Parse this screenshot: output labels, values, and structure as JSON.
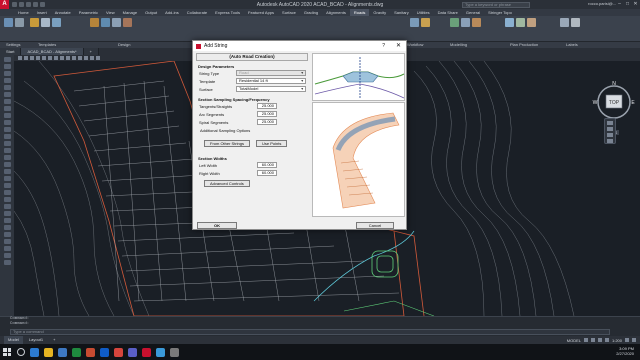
{
  "titlebar": {
    "app_title": "Autodesk AutoCAD 2020  ACAD_BCAD - Alignments.dwg",
    "search_placeholder": "Type a keyword or phrase",
    "user": "rocco.parisi@...",
    "logo_letter": "A"
  },
  "ribbon_tabs": [
    "Home",
    "Insert",
    "Annotate",
    "Parametric",
    "View",
    "Manage",
    "Output",
    "Add-ins",
    "Collaborate",
    "Express Tools",
    "Featured Apps",
    "Surface",
    "Grading",
    "Alignments",
    "Roads",
    "Gravity",
    "Sanitary",
    "Utilities",
    "Data Share",
    "General",
    "Stringer Topo"
  ],
  "active_tab_index": 14,
  "ribbon_panel_labels": [
    "Settings",
    "Templates",
    "Design",
    "Workflow",
    "Modelling",
    "Plan Production",
    "Labels"
  ],
  "file_tabs": [
    "Start",
    "ACAD_BCAD - Alignments*"
  ],
  "dialog": {
    "title": "Add String",
    "help": "?",
    "close": "✕",
    "subtitle": "(Auto Road Creation)",
    "design_params_heading": "Design Parameters",
    "string_type_label": "String Type",
    "string_type_value": "Road",
    "template_label": "Template",
    "template_value": "Residential 14 ft",
    "surface_label": "Surface",
    "surface_value": "TotalModel",
    "sampling_heading": "Section Sampling Spacing/Frequency",
    "tangents_label": "Tangents/Straights",
    "tangents_value": "25.000",
    "arc_label": "Arc Segments",
    "arc_value": "25.000",
    "spiral_label": "Spiral Segments",
    "spiral_value": "25.000",
    "additional_label": "Additional Sampling Options",
    "from_other_btn": "From Other Strings",
    "use_points_btn": "Use Points",
    "widths_heading": "Section Widths",
    "left_width_label": "Left Width",
    "left_width_value": "60.000",
    "right_width_label": "Right Width",
    "right_width_value": "60.000",
    "advanced_btn": "Advanced Controls",
    "ok_btn": "OK",
    "cancel_btn": "Cancel"
  },
  "viewcube": {
    "top": "TOP",
    "n": "N",
    "s": "S",
    "e": "E",
    "w": "W",
    "wcs": "WCS"
  },
  "command": {
    "line1": "Command:",
    "line2": "Command:",
    "placeholder": "Type a command"
  },
  "layout_tabs": [
    "Model",
    "Layout1",
    "+"
  ],
  "status": {
    "model": "MODEL",
    "scale": "1:200",
    "time": "3:09 PM",
    "date": "2/27/2020"
  }
}
